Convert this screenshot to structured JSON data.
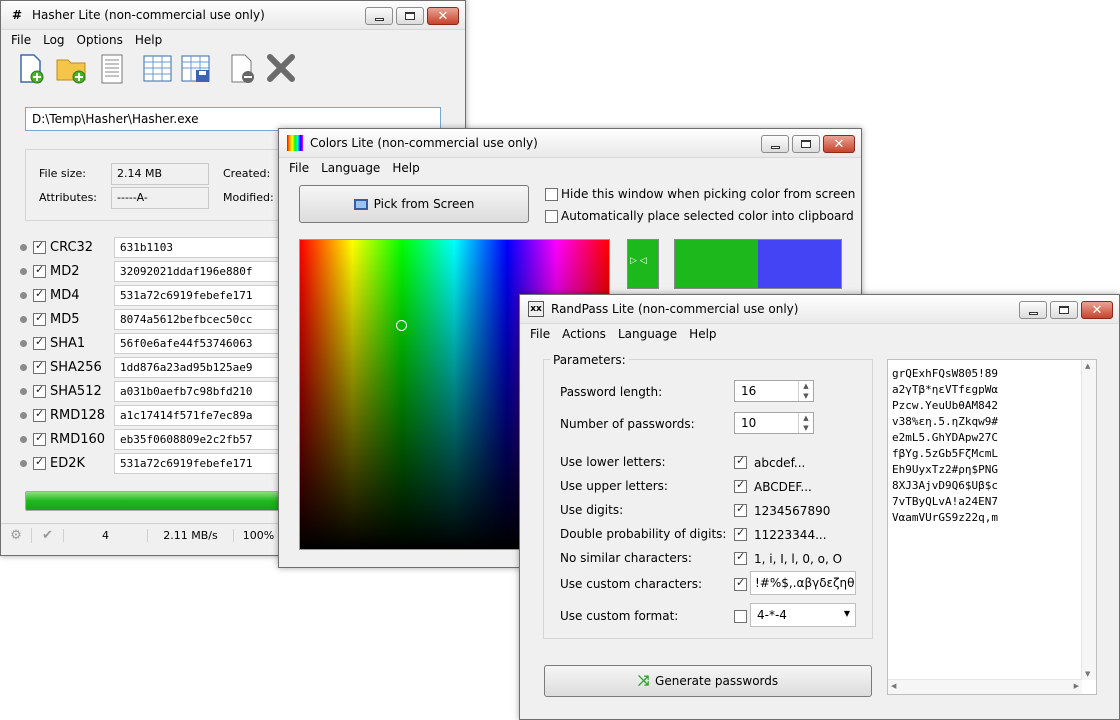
{
  "hasher": {
    "title": "Hasher Lite (non-commercial use only)",
    "menu": [
      "File",
      "Log",
      "Options",
      "Help"
    ],
    "path": "D:\\Temp\\Hasher\\Hasher.exe",
    "labels": {
      "file_size": "File size:",
      "attributes": "Attributes:",
      "created": "Created:",
      "modified": "Modified:"
    },
    "values": {
      "file_size": "2.14 MB",
      "attributes": "-----A-"
    },
    "hashes": [
      {
        "name": "CRC32",
        "value": "631b1103"
      },
      {
        "name": "MD2",
        "value": "32092021ddaf196e880f"
      },
      {
        "name": "MD4",
        "value": "531a72c6919febefe171"
      },
      {
        "name": "MD5",
        "value": "8074a5612befbcec50cc"
      },
      {
        "name": "SHA1",
        "value": "56f0e6afe44f53746063"
      },
      {
        "name": "SHA256",
        "value": "1dd876a23ad95b125ae9"
      },
      {
        "name": "SHA512",
        "value": "a031b0aefb7c98bfd210"
      },
      {
        "name": "RMD128",
        "value": "a1c17414f571fe7ec89a"
      },
      {
        "name": "RMD160",
        "value": "eb35f0608809e2c2fb57"
      },
      {
        "name": "ED2K",
        "value": "531a72c6919febefe171"
      }
    ],
    "progress": 0.85,
    "status": {
      "count": "4",
      "speed": "2.11 MB/s",
      "percent": "100%"
    }
  },
  "colors": {
    "title": "Colors Lite (non-commercial use only)",
    "menu": [
      "File",
      "Language",
      "Help"
    ],
    "pick_button": "Pick from Screen",
    "hide_option": "Hide this window when picking color from screen",
    "clipboard_option": "Automatically place selected color into clipboard",
    "hide_checked": false,
    "clipboard_checked": false,
    "color_new": "#1cb81c",
    "color_old": "#4444f4"
  },
  "randpass": {
    "title": "RandPass Lite (non-commercial use only)",
    "menu": [
      "File",
      "Actions",
      "Language",
      "Help"
    ],
    "group": "Parameters:",
    "password_length_label": "Password length:",
    "password_length": "16",
    "count_label": "Number of passwords:",
    "count": "10",
    "options": [
      {
        "label": "Use lower letters:",
        "checked": true,
        "value": "abcdef..."
      },
      {
        "label": "Use upper letters:",
        "checked": true,
        "value": "ABCDEF..."
      },
      {
        "label": "Use digits:",
        "checked": true,
        "value": "1234567890"
      },
      {
        "label": "Double probability of digits:",
        "checked": true,
        "value": "11223344..."
      },
      {
        "label": "No similar characters:",
        "checked": true,
        "value": "1, i, I, l, 0, o, O"
      }
    ],
    "custom_chars_label": "Use custom characters:",
    "custom_chars": "!#%$,.αβγδεζηθ",
    "custom_format_label": "Use custom format:",
    "custom_format": "4-*-4",
    "generate_button": "Generate passwords",
    "passwords": [
      "grQExhFQsW805!89",
      "a2γTβ*ηεVTfεgpWα",
      "Pzcw.YeuUbθAM842",
      "v38%εη.5.ηZkqw9#",
      "e2mL5.GhYDApw27C",
      "fβYg.5zGb5FζMcmL",
      "Eh9UyxTz2#ρη$PNG",
      "8XJ3AjvD9Q6$Uβ$c",
      "7vTByQLvA!a24EN7",
      "VαamVUrGS9z22q,m"
    ]
  }
}
